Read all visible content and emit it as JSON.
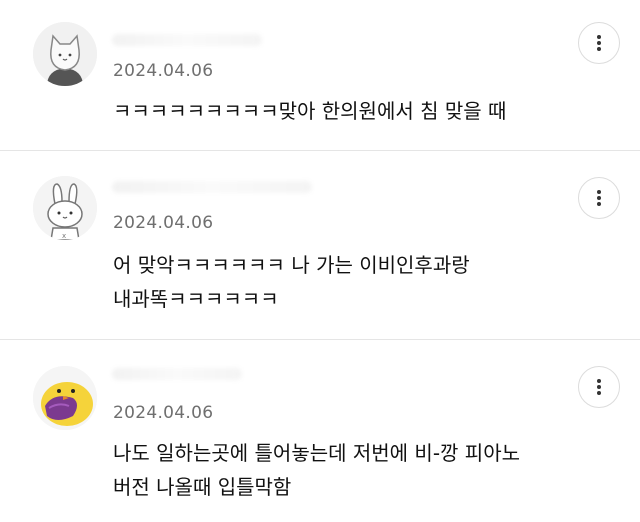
{
  "comments": [
    {
      "date": "2024.04.06",
      "text": "ㅋㅋㅋㅋㅋㅋㅋㅋㅋ맞아 한의원에서 침 맞을 때",
      "avatar_icon": "cat-avatar-icon"
    },
    {
      "date": "2024.04.06",
      "text": "어 맞악ㅋㅋㅋㅋㅋㅋ 나 가는 이비인후과랑\n내과똑ㅋㅋㅋㅋㅋㅋ",
      "avatar_icon": "bunny-avatar-icon"
    },
    {
      "date": "2024.04.06",
      "text": "나도 일하는곳에 틀어놓는데 저번에 비-깡 피아노\n버전 나올때 입틀막함",
      "avatar_icon": "chick-avatar-icon"
    }
  ],
  "more_icon": "more-vertical-icon",
  "colors": {
    "date": "#6f6f6f",
    "divider": "#e5e5e5",
    "chick": "#f5d33a",
    "sweet_potato": "#7b3a8f"
  }
}
